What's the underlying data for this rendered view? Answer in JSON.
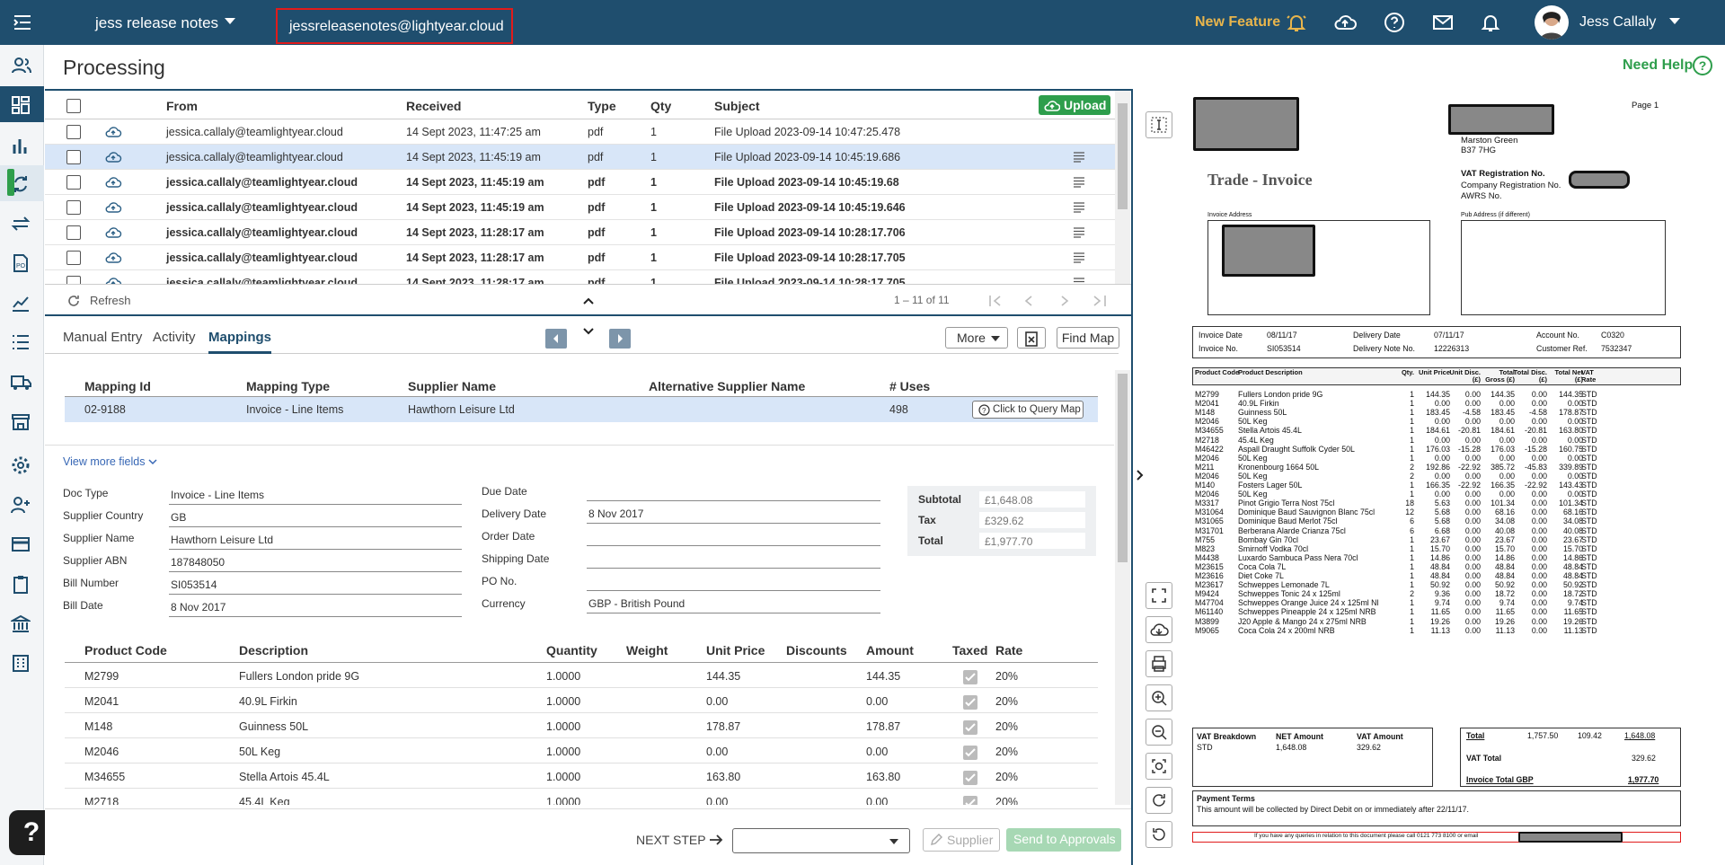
{
  "topbar": {
    "tenant": "jess release notes",
    "email": "jessreleasenotes@lightyear.cloud",
    "new_feature": "New Feature",
    "user_name": "Jess Callaly"
  },
  "page": {
    "title": "Processing",
    "need_help": "Need Help",
    "help_fab": "?"
  },
  "inbox": {
    "columns": [
      "From",
      "Received",
      "Type",
      "Qty",
      "Subject"
    ],
    "upload_label": "Upload",
    "rows": [
      {
        "from": "jessica.callaly@teamlightyear.cloud",
        "received": "14 Sept 2023, 11:47:25 am",
        "type": "pdf",
        "qty": "1",
        "subject": "File Upload 2023-09-14 10:47:25.478"
      },
      {
        "from": "jessica.callaly@teamlightyear.cloud",
        "received": "14 Sept 2023, 11:45:19 am",
        "type": "pdf",
        "qty": "1",
        "subject": "File Upload 2023-09-14 10:45:19.686"
      },
      {
        "from": "jessica.callaly@teamlightyear.cloud",
        "received": "14 Sept 2023, 11:45:19 am",
        "type": "pdf",
        "qty": "1",
        "subject": "File Upload 2023-09-14 10:45:19.68"
      },
      {
        "from": "jessica.callaly@teamlightyear.cloud",
        "received": "14 Sept 2023, 11:45:19 am",
        "type": "pdf",
        "qty": "1",
        "subject": "File Upload 2023-09-14 10:45:19.646"
      },
      {
        "from": "jessica.callaly@teamlightyear.cloud",
        "received": "14 Sept 2023, 11:28:17 am",
        "type": "pdf",
        "qty": "1",
        "subject": "File Upload 2023-09-14 10:28:17.706"
      },
      {
        "from": "jessica.callaly@teamlightyear.cloud",
        "received": "14 Sept 2023, 11:28:17 am",
        "type": "pdf",
        "qty": "1",
        "subject": "File Upload 2023-09-14 10:28:17.705"
      },
      {
        "from": "jessica.callaly@teamlightyear.cloud",
        "received": "14 Sept 2023, 11:28:17 am",
        "type": "pdf",
        "qty": "1",
        "subject": "File Upload 2023-09-14 10:28:17.705"
      }
    ],
    "refresh": "Refresh",
    "count": "1 – 11 of 11"
  },
  "tabs": {
    "manual": "Manual Entry",
    "activity": "Activity",
    "mappings": "Mappings",
    "more": "More",
    "find_map": "Find Map"
  },
  "mapping": {
    "columns": [
      "Mapping Id",
      "Mapping Type",
      "Supplier Name",
      "Alternative Supplier Name",
      "# Uses"
    ],
    "row": {
      "id": "02-9188",
      "type": "Invoice - Line Items",
      "supplier": "Hawthorn Leisure Ltd",
      "alt": "",
      "uses": "498"
    },
    "query_btn": "Click to Query Map",
    "view_more": "View more fields"
  },
  "form": {
    "doc_type_label": "Doc Type",
    "doc_type": "Invoice - Line Items",
    "supplier_country_label": "Supplier Country",
    "supplier_country": "GB",
    "supplier_name_label": "Supplier Name",
    "supplier_name": "Hawthorn Leisure Ltd",
    "supplier_abn_label": "Supplier ABN",
    "supplier_abn": "187848050",
    "bill_number_label": "Bill Number",
    "bill_number": "SI053514",
    "bill_date_label": "Bill Date",
    "bill_date": "8 Nov 2017",
    "due_date_label": "Due Date",
    "due_date": "",
    "delivery_date_label": "Delivery Date",
    "delivery_date": "8 Nov 2017",
    "order_date_label": "Order Date",
    "order_date": "",
    "shipping_date_label": "Shipping Date",
    "shipping_date": "",
    "po_label": "PO No.",
    "po": "",
    "currency_label": "Currency",
    "currency": "GBP - British Pound"
  },
  "totals": {
    "subtotal_label": "Subtotal",
    "subtotal": "£1,648.08",
    "tax_label": "Tax",
    "tax": "£329.62",
    "total_label": "Total",
    "total": "£1,977.70"
  },
  "lines": {
    "columns": [
      "Product Code",
      "Description",
      "Quantity",
      "Weight",
      "Unit Price",
      "Discounts",
      "Amount",
      "Taxed",
      "Rate"
    ],
    "rows": [
      {
        "code": "M2799",
        "desc": "Fullers London pride 9G",
        "qty": "1.0000",
        "price": "144.35",
        "amount": "144.35",
        "rate": "20%"
      },
      {
        "code": "M2041",
        "desc": "40.9L Firkin",
        "qty": "1.0000",
        "price": "0.00",
        "amount": "0.00",
        "rate": "20%"
      },
      {
        "code": "M148",
        "desc": "Guinness 50L",
        "qty": "1.0000",
        "price": "178.87",
        "amount": "178.87",
        "rate": "20%"
      },
      {
        "code": "M2046",
        "desc": "50L Keg",
        "qty": "1.0000",
        "price": "0.00",
        "amount": "0.00",
        "rate": "20%"
      },
      {
        "code": "M34655",
        "desc": "Stella Artois 45.4L",
        "qty": "1.0000",
        "price": "163.80",
        "amount": "163.80",
        "rate": "20%"
      },
      {
        "code": "M2718",
        "desc": "45.4L Keg",
        "qty": "1.0000",
        "price": "0.00",
        "amount": "0.00",
        "rate": "20%"
      }
    ]
  },
  "footer": {
    "next_step": "NEXT STEP",
    "supplier": "Supplier",
    "send": "Send to Approvals"
  },
  "doc": {
    "page": "Page 1",
    "addr1": "Marston Green",
    "addr2": "B37 7HG",
    "title": "Trade - Invoice",
    "vat_reg": "VAT Registration No.",
    "company_reg": "Company Registration No.",
    "awrs": "AWRS No.",
    "invoice_address": "Invoice Address",
    "pub_address": "Pub Address (if different)",
    "invoice_date_l": "Invoice Date",
    "invoice_date": "08/11/17",
    "delivery_date_l": "Delivery Date",
    "delivery_date": "07/11/17",
    "account_l": "Account No.",
    "account": "C0320",
    "invoice_no_l": "Invoice No.",
    "invoice_no": "SI053514",
    "delivery_note_l": "Delivery Note No.",
    "delivery_note": "12226313",
    "customer_ref_l": "Customer Ref.",
    "customer_ref": "7532347",
    "cols": [
      "Product Code",
      "Product Description",
      "Qty.",
      "Unit Price",
      "Unit Disc. (£)",
      "Total Gross (£)",
      "Total Disc. (£)",
      "Total Net (£)",
      "VAT Rate"
    ],
    "items": [
      [
        "M2799",
        "Fullers London pride 9G",
        "1",
        "144.35",
        "0.00",
        "144.35",
        "0.00",
        "144.35",
        "STD"
      ],
      [
        "M2041",
        "40.9L Firkin",
        "1",
        "0.00",
        "0.00",
        "0.00",
        "0.00",
        "0.00",
        "STD"
      ],
      [
        "M148",
        "Guinness 50L",
        "1",
        "183.45",
        "-4.58",
        "183.45",
        "-4.58",
        "178.87",
        "STD"
      ],
      [
        "M2046",
        "50L Keg",
        "1",
        "0.00",
        "0.00",
        "0.00",
        "0.00",
        "0.00",
        "STD"
      ],
      [
        "M34655",
        "Stella Artois 45.4L",
        "1",
        "184.61",
        "-20.81",
        "184.61",
        "-20.81",
        "163.80",
        "STD"
      ],
      [
        "M2718",
        "45.4L Keg",
        "1",
        "0.00",
        "0.00",
        "0.00",
        "0.00",
        "0.00",
        "STD"
      ],
      [
        "M46422",
        "Aspall Draught Suffolk Cyder 50L",
        "1",
        "176.03",
        "-15.28",
        "176.03",
        "-15.28",
        "160.75",
        "STD"
      ],
      [
        "M2046",
        "50L Keg",
        "1",
        "0.00",
        "0.00",
        "0.00",
        "0.00",
        "0.00",
        "STD"
      ],
      [
        "M211",
        "Kronenbourg 1664 50L",
        "2",
        "192.86",
        "-22.92",
        "385.72",
        "-45.83",
        "339.89",
        "STD"
      ],
      [
        "M2046",
        "50L Keg",
        "2",
        "0.00",
        "0.00",
        "0.00",
        "0.00",
        "0.00",
        "STD"
      ],
      [
        "M140",
        "Fosters Lager 50L",
        "1",
        "166.35",
        "-22.92",
        "166.35",
        "-22.92",
        "143.43",
        "STD"
      ],
      [
        "M2046",
        "50L Keg",
        "1",
        "0.00",
        "0.00",
        "0.00",
        "0.00",
        "0.00",
        "STD"
      ],
      [
        "M3317",
        "Pinot Grigio Terra Nost 75cl",
        "18",
        "5.63",
        "0.00",
        "101.34",
        "0.00",
        "101.34",
        "STD"
      ],
      [
        "M31064",
        "Dominique Baud Sauvignon Blanc 75cl",
        "12",
        "5.68",
        "0.00",
        "68.16",
        "0.00",
        "68.16",
        "STD"
      ],
      [
        "M31065",
        "Dominique Baud Merlot 75cl",
        "6",
        "5.68",
        "0.00",
        "34.08",
        "0.00",
        "34.08",
        "STD"
      ],
      [
        "M31701",
        "Berberana Alarde Crianza 75cl",
        "6",
        "6.68",
        "0.00",
        "40.08",
        "0.00",
        "40.08",
        "STD"
      ],
      [
        "M755",
        "Bombay Gin 70cl",
        "1",
        "23.67",
        "0.00",
        "23.67",
        "0.00",
        "23.67",
        "STD"
      ],
      [
        "M823",
        "Smirnoff Vodka 70cl",
        "1",
        "15.70",
        "0.00",
        "15.70",
        "0.00",
        "15.70",
        "STD"
      ],
      [
        "M4438",
        "Luxardo Sambuca Pass Nera 70cl",
        "1",
        "14.86",
        "0.00",
        "14.86",
        "0.00",
        "14.86",
        "STD"
      ],
      [
        "M23615",
        "Coca Cola 7L",
        "1",
        "48.84",
        "0.00",
        "48.84",
        "0.00",
        "48.84",
        "STD"
      ],
      [
        "M23616",
        "Diet Coke 7L",
        "1",
        "48.84",
        "0.00",
        "48.84",
        "0.00",
        "48.84",
        "STD"
      ],
      [
        "M23617",
        "Schweppes Lemonade 7L",
        "1",
        "50.92",
        "0.00",
        "50.92",
        "0.00",
        "50.92",
        "STD"
      ],
      [
        "M9424",
        "Schweppes Tonic 24 x 125ml",
        "2",
        "9.36",
        "0.00",
        "18.72",
        "0.00",
        "18.72",
        "STD"
      ],
      [
        "M47704",
        "Schweppes Orange Juice 24 x 125ml NRB",
        "1",
        "9.74",
        "0.00",
        "9.74",
        "0.00",
        "9.74",
        "STD"
      ],
      [
        "M61140",
        "Schweppes Pineapple 24 x 125ml NRB",
        "1",
        "11.65",
        "0.00",
        "11.65",
        "0.00",
        "11.65",
        "STD"
      ],
      [
        "M3899",
        "J20 Apple & Mango 24 x 275ml NRB",
        "1",
        "19.26",
        "0.00",
        "19.26",
        "0.00",
        "19.26",
        "STD"
      ],
      [
        "M9065",
        "Coca Cola 24 x 200ml NRB",
        "1",
        "11.13",
        "0.00",
        "11.13",
        "0.00",
        "11.13",
        "STD"
      ]
    ],
    "vat_breakdown": "VAT Breakdown",
    "net_amount": "NET Amount",
    "vat_amount": "VAT Amount",
    "std": "STD",
    "std_net": "1,648.08",
    "std_vat": "329.62",
    "total_l": "Total",
    "total_gross": "1,757.50",
    "total_disc": "109.42",
    "total_net": "1,648.08",
    "vat_total_l": "VAT Total",
    "vat_total": "329.62",
    "invoice_total_l": "Invoice Total GBP",
    "invoice_total": "1,977.70",
    "payment_terms": "Payment Terms",
    "payment_text": "This amount will be collected by Direct Debit on or immediately after 22/11/17.",
    "queries": "If you have any queries in relation to this document please call 0121 773 8100 or email"
  }
}
